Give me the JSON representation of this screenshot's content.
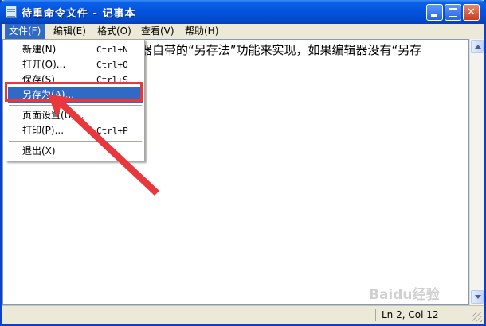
{
  "window": {
    "title": "待重命令文件 - 记事本",
    "min_glyph": "",
    "max_glyph": "",
    "close_glyph": "✕"
  },
  "menubar": {
    "file": "文件(F)",
    "edit": "编辑(E)",
    "format": "格式(O)",
    "view": "查看(V)",
    "help": "帮助(H)"
  },
  "editor": {
    "line1": "器自带的“另存法”功能来实现，如果编辑器没有“另存"
  },
  "file_menu": {
    "items": [
      {
        "label": "新建(N)",
        "shortcut": "Ctrl+N"
      },
      {
        "label": "打开(O)...",
        "shortcut": "Ctrl+O"
      },
      {
        "label": "保存(S)",
        "shortcut": "Ctrl+S"
      },
      {
        "label": "另存为(A)...",
        "shortcut": ""
      },
      {
        "label": "页面设置(U)...",
        "shortcut": ""
      },
      {
        "label": "打印(P)...",
        "shortcut": "Ctrl+P"
      },
      {
        "label": "退出(X)",
        "shortcut": ""
      }
    ],
    "highlighted_index": 3
  },
  "statusbar": {
    "position": "Ln 2, Col 12"
  },
  "watermark": "Baidu经验",
  "colors": {
    "title_blue": "#0453dd",
    "menu_highlight": "#316ac5",
    "annotation_red": "#e8383d"
  }
}
